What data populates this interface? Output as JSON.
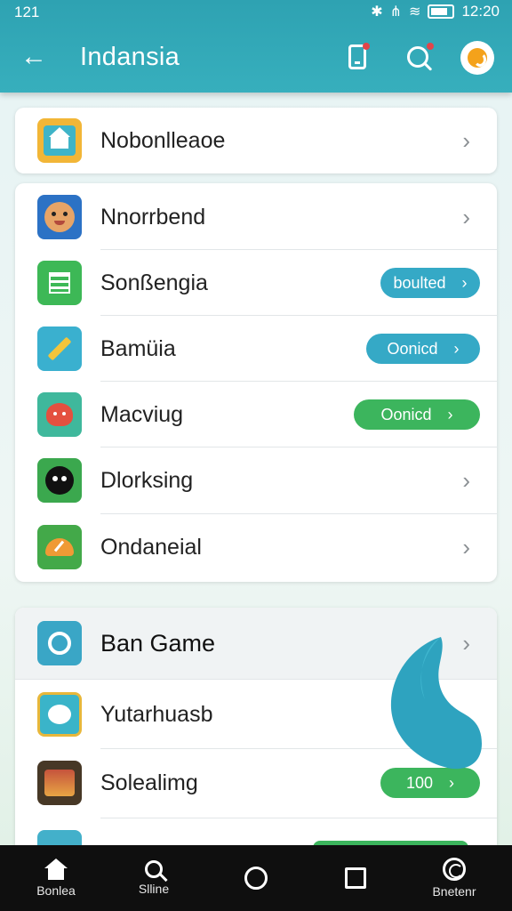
{
  "status_bar": {
    "time_left": "121",
    "time_right": "12:20"
  },
  "app_bar": {
    "title": "Indansia",
    "back_icon": "back-arrow-icon"
  },
  "card1": {
    "items": [
      {
        "label": "Nobonlleaoe",
        "icon": "home-icon"
      }
    ]
  },
  "card2": {
    "items": [
      {
        "label": "Nnorrbend",
        "icon": "face-icon"
      },
      {
        "label": "Sonßengia",
        "icon": "list-icon",
        "pill": "boulted"
      },
      {
        "label": "Bamüia",
        "icon": "pencil-icon",
        "pill": "Oonicd"
      },
      {
        "label": "Macviug",
        "icon": "fox-icon",
        "pill": "Oonicd"
      },
      {
        "label": "Dlorksing",
        "icon": "face-circle-icon"
      },
      {
        "label": "Ondaneial",
        "icon": "gauge-icon"
      }
    ]
  },
  "card3": {
    "items": [
      {
        "label": "Ban Game",
        "icon": "people-icon"
      },
      {
        "label": "Yutarhuasb",
        "icon": "bird-icon"
      },
      {
        "label": "Solealimg",
        "icon": "game-icon",
        "pill": "100"
      }
    ]
  },
  "nav": {
    "items": [
      {
        "label": "Bonlea",
        "icon": "home-icon"
      },
      {
        "label": "Slline",
        "icon": "search-icon"
      },
      {
        "label": "",
        "icon": "circle-icon"
      },
      {
        "label": "",
        "icon": "square-icon"
      },
      {
        "label": "Bnetenr",
        "icon": "profile-icon"
      }
    ]
  },
  "colors": {
    "accent": "#35a9c6",
    "green": "#3cb55d",
    "appbar": "#2ea2b2"
  }
}
